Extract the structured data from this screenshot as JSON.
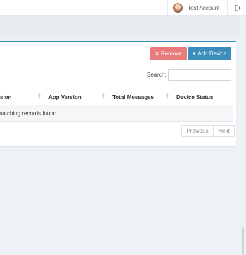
{
  "header": {
    "user_name": "Test Account",
    "logout_icon": "sign-out-icon"
  },
  "toolbar": {
    "remove_label": "Remove",
    "remove_icon": "×",
    "add_label": "Add Device",
    "add_icon": "+",
    "remove_color": "#e87c7c",
    "add_color": "#3c8dbc"
  },
  "search": {
    "label": "Search:",
    "value": "",
    "placeholder": ""
  },
  "table": {
    "columns": [
      "sion",
      "App Version",
      "Total Messages",
      "Device Status"
    ],
    "empty_message": "o matching records found"
  },
  "pagination": {
    "previous_label": "Previous",
    "next_label": "Next"
  },
  "colors": {
    "accent": "#3c8dbc",
    "background": "#eef1f5"
  }
}
